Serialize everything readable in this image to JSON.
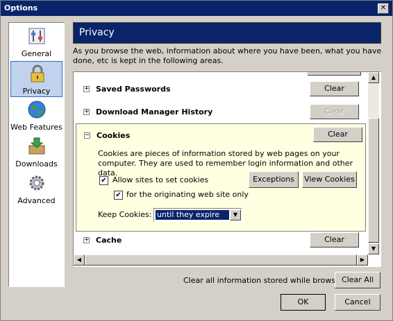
{
  "window": {
    "title": "Options",
    "close_glyph": "✕"
  },
  "sidebar": {
    "items": [
      {
        "label": "General",
        "icon": "general-icon",
        "selected": false
      },
      {
        "label": "Privacy",
        "icon": "lock-icon",
        "selected": true
      },
      {
        "label": "Web Features",
        "icon": "globe-icon",
        "selected": false
      },
      {
        "label": "Downloads",
        "icon": "download-box-icon",
        "selected": false
      },
      {
        "label": "Advanced",
        "icon": "gear-icon",
        "selected": false
      }
    ]
  },
  "panel": {
    "title": "Privacy",
    "intro": "As you browse the web, information about where you have been, what you have done, etc is kept in the following areas."
  },
  "sections": {
    "saved_passwords": {
      "label": "Saved Passwords",
      "clear": "Clear",
      "clear_enabled": true
    },
    "download_history": {
      "label": "Download Manager History",
      "clear": "Clear",
      "clear_enabled": false
    },
    "cookies": {
      "label": "Cookies",
      "clear": "Clear",
      "description": "Cookies are pieces of information stored by web pages on your computer. They are used to remember login information and other data.",
      "allow_label": "Allow sites to set cookies",
      "allow_checked": true,
      "origin_only_label": "for the originating web site only",
      "origin_only_checked": true,
      "exceptions": "Exceptions",
      "view_cookies": "View Cookies",
      "keep_label": "Keep Cookies:",
      "keep_value": "until they expire"
    },
    "cache": {
      "label": "Cache",
      "clear": "Clear"
    }
  },
  "footer": {
    "clear_all_label": "Clear all information stored while browsing:",
    "clear_all": "Clear All",
    "ok": "OK",
    "cancel": "Cancel"
  },
  "glyphs": {
    "expand": "+",
    "collapse": "−",
    "check": "✔",
    "up": "▲",
    "down": "▼",
    "left": "◀",
    "right": "▶"
  },
  "colors": {
    "title_bar": "#0a246a",
    "selection": "#c1d2ee",
    "cookies_bg": "#ffffe1",
    "face": "#d4d0c8"
  }
}
